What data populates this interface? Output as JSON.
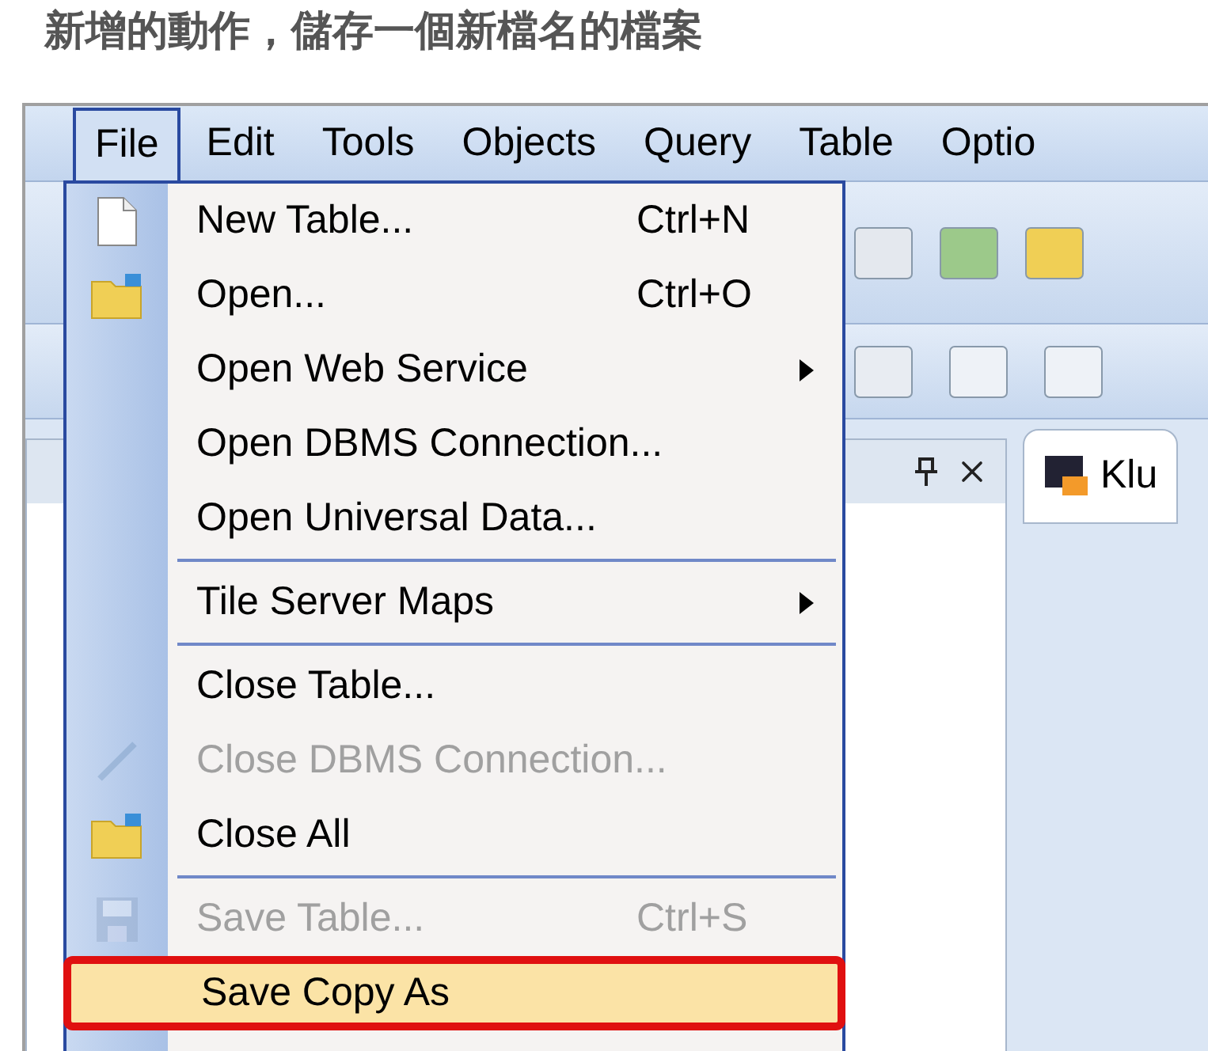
{
  "heading": "新增的動作，儲存一個新檔名的檔案",
  "menu_bar": [
    {
      "label": "File",
      "selected": true
    },
    {
      "label": "Edit",
      "selected": false
    },
    {
      "label": "Tools",
      "selected": false
    },
    {
      "label": "Objects",
      "selected": false
    },
    {
      "label": "Query",
      "selected": false
    },
    {
      "label": "Table",
      "selected": false
    },
    {
      "label": "Optio",
      "selected": false
    }
  ],
  "document_tab": {
    "title": "Klu"
  },
  "file_menu": [
    {
      "kind": "item",
      "label": "New Table...",
      "shortcut": "Ctrl+N",
      "submenu": false,
      "disabled": false,
      "highlighted": false
    },
    {
      "kind": "item",
      "label": "Open...",
      "shortcut": "Ctrl+O",
      "submenu": false,
      "disabled": false,
      "highlighted": false
    },
    {
      "kind": "item",
      "label": "Open Web Service",
      "submenu": true,
      "disabled": false,
      "highlighted": false
    },
    {
      "kind": "item",
      "label": "Open DBMS Connection...",
      "submenu": false,
      "disabled": false,
      "highlighted": false
    },
    {
      "kind": "item",
      "label": "Open Universal Data...",
      "submenu": false,
      "disabled": false,
      "highlighted": false
    },
    {
      "kind": "separator"
    },
    {
      "kind": "item",
      "label": "Tile Server Maps",
      "submenu": true,
      "disabled": false,
      "highlighted": false
    },
    {
      "kind": "separator"
    },
    {
      "kind": "item",
      "label": "Close Table...",
      "submenu": false,
      "disabled": false,
      "highlighted": false
    },
    {
      "kind": "item",
      "label": "Close DBMS Connection...",
      "submenu": false,
      "disabled": true,
      "highlighted": false
    },
    {
      "kind": "item",
      "label": "Close All",
      "submenu": false,
      "disabled": false,
      "highlighted": false
    },
    {
      "kind": "separator"
    },
    {
      "kind": "item",
      "label": "Save Table...",
      "shortcut": "Ctrl+S",
      "submenu": false,
      "disabled": true,
      "highlighted": false
    },
    {
      "kind": "item",
      "label": "Save Copy As",
      "submenu": false,
      "disabled": false,
      "highlighted": true
    }
  ]
}
